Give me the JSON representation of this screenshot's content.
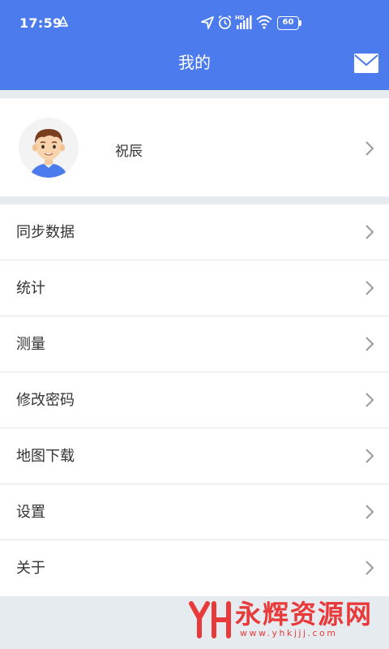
{
  "status_bar": {
    "time": "17:59",
    "battery": "60",
    "icons": [
      "notification-a-icon",
      "location-icon",
      "alarm-icon",
      "signal-hd-icon",
      "wifi-icon",
      "battery-icon"
    ]
  },
  "header": {
    "title": "我的",
    "mail_icon": "mail-icon"
  },
  "profile": {
    "name": "祝辰",
    "avatar": "avatar-boy"
  },
  "menu": {
    "items": [
      {
        "label": "同步数据"
      },
      {
        "label": "统计"
      },
      {
        "label": "测量"
      },
      {
        "label": "修改密码"
      },
      {
        "label": "地图下载"
      },
      {
        "label": "设置"
      },
      {
        "label": "关于"
      }
    ]
  },
  "watermark": {
    "text": "永辉资源网",
    "url": "www.yhkjjj.com"
  },
  "colors": {
    "header": "#4b7bec",
    "background": "#e6ebf0",
    "watermark": "#e83a3a"
  }
}
